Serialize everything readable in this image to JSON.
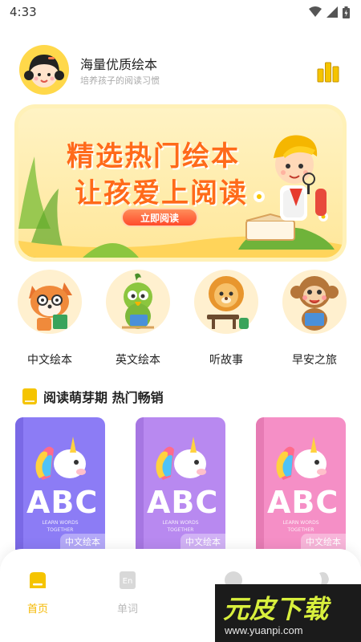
{
  "status_bar": {
    "time": "4:33"
  },
  "header": {
    "title": "海量优质绘本",
    "subtitle": "培养孩子的阅读习惯"
  },
  "banner": {
    "line1": "精选热门绘本",
    "line2": "让孩爱上阅读",
    "button_label": "立即阅读"
  },
  "categories": [
    {
      "label": "中文绘本",
      "icon": "fox-icon"
    },
    {
      "label": "英文绘本",
      "icon": "parrot-icon"
    },
    {
      "label": "听故事",
      "icon": "lion-icon"
    },
    {
      "label": "早安之旅",
      "icon": "monkey-icon"
    }
  ],
  "section": {
    "title": "阅读萌芽期 热门畅销"
  },
  "books": [
    {
      "cover_text": "ABC",
      "subtitle1": "LEARN WORDS",
      "subtitle2": "TOGETHER",
      "tag": "中文绘本",
      "color": "#8c7cf5"
    },
    {
      "cover_text": "ABC",
      "subtitle1": "LEARN WORDS",
      "subtitle2": "TOGETHER",
      "tag": "中文绘本",
      "color": "#b889f0"
    },
    {
      "cover_text": "ABC",
      "subtitle1": "LEARN WORDS",
      "subtitle2": "TOGETHER",
      "tag": "中文绘本",
      "color": "#f58fc6"
    }
  ],
  "bottom_nav": [
    {
      "label": "首页",
      "active": true
    },
    {
      "label": "单词",
      "active": false
    }
  ],
  "watermark": {
    "title": "元皮下载",
    "url": "www.yuanpi.com"
  },
  "colors": {
    "accent": "#f5b800",
    "banner_text": "#ff6a1a"
  }
}
